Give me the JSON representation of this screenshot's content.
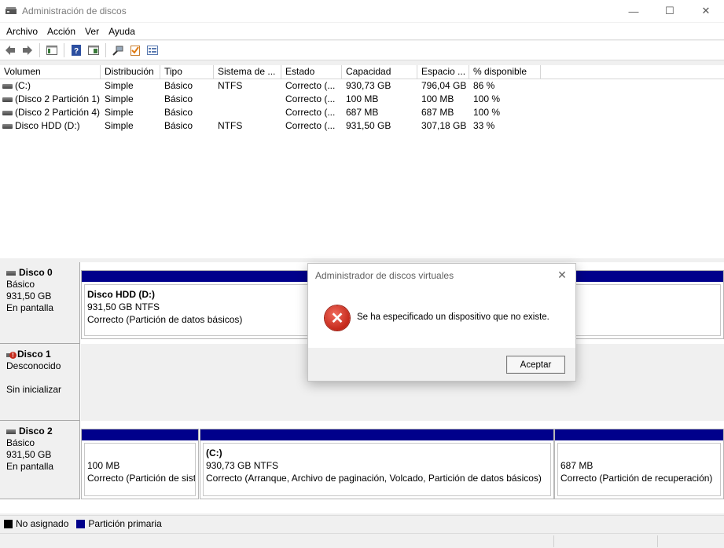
{
  "window": {
    "title": "Administración de discos",
    "minimize": "—",
    "maximize": "☐",
    "close": "✕"
  },
  "menu": [
    "Archivo",
    "Acción",
    "Ver",
    "Ayuda"
  ],
  "toolbar_icons": [
    "back-arrow-icon",
    "forward-arrow-icon",
    "console-tree-icon",
    "help-icon",
    "properties-icon",
    "connect-icon",
    "checklist-icon",
    "view-icon"
  ],
  "volumes": {
    "columns": [
      "Volumen",
      "Distribución",
      "Tipo",
      "Sistema de ...",
      "Estado",
      "Capacidad",
      "Espacio ...",
      "% disponible"
    ],
    "rows": [
      [
        "(C:)",
        "Simple",
        "Básico",
        "NTFS",
        "Correcto (...",
        "930,73 GB",
        "796,04 GB",
        "86 %"
      ],
      [
        "(Disco 2 Partición 1)",
        "Simple",
        "Básico",
        "",
        "Correcto (...",
        "100 MB",
        "100 MB",
        "100 %"
      ],
      [
        "(Disco 2 Partición 4)",
        "Simple",
        "Básico",
        "",
        "Correcto (...",
        "687 MB",
        "687 MB",
        "100 %"
      ],
      [
        "Disco HDD (D:)",
        "Simple",
        "Básico",
        "NTFS",
        "Correcto (...",
        "931,50 GB",
        "307,18 GB",
        "33 %"
      ]
    ]
  },
  "disks": {
    "disk0": {
      "name": "Disco 0",
      "type": "Básico",
      "size": "931,50 GB",
      "status": "En pantalla",
      "partition": {
        "title": "Disco HDD  (D:)",
        "size_fs": "931,50 GB NTFS",
        "status": "Correcto (Partición de datos básicos)"
      }
    },
    "disk1": {
      "name": "Disco 1",
      "type": "Desconocido",
      "status": "Sin inicializar"
    },
    "disk2": {
      "name": "Disco 2",
      "type": "Básico",
      "size": "931,50 GB",
      "status": "En pantalla",
      "partitions": [
        {
          "title": "",
          "size_fs": "100 MB",
          "status": "Correcto (Partición de sist"
        },
        {
          "title": "(C:)",
          "size_fs": "930,73 GB NTFS",
          "status": "Correcto (Arranque, Archivo de paginación, Volcado, Partición de datos básicos)"
        },
        {
          "title": "",
          "size_fs": "687 MB",
          "status": "Correcto (Partición de recuperación)"
        }
      ]
    }
  },
  "legend": {
    "unallocated": "No asignado",
    "primary": "Partición primaria",
    "colors": {
      "unallocated": "#000000",
      "primary": "#00008b"
    }
  },
  "dialog": {
    "title": "Administrador de discos virtuales",
    "message": "Se ha especificado un dispositivo que no existe.",
    "ok": "Aceptar",
    "close": "✕",
    "icon": "error-icon"
  }
}
